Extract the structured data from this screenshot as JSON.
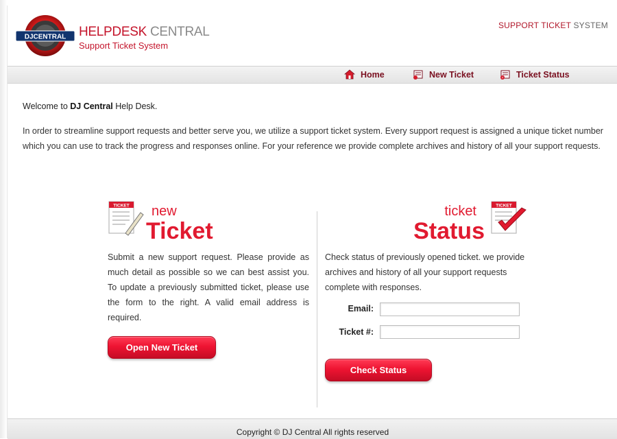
{
  "header": {
    "logo_text": "DJCENTRAL",
    "title_strong": "HELPDESK",
    "title_soft": "CENTRAL",
    "subtitle": "Support Ticket System",
    "system_label_strong": "SUPPORT TICKET",
    "system_label_soft": "SYSTEM"
  },
  "nav": {
    "items": [
      {
        "label": "Home",
        "icon": "home-icon"
      },
      {
        "label": "New Ticket",
        "icon": "new-ticket-icon"
      },
      {
        "label": "Ticket Status",
        "icon": "ticket-status-icon"
      }
    ]
  },
  "intro": {
    "welcome_prefix": "Welcome to",
    "welcome_brand": "DJ Central",
    "welcome_suffix": "Help Desk.",
    "paragraph": "In order to streamline support requests and better serve you, we utilize a support ticket system. Every support request is assigned a unique ticket number which you can use to track the progress and responses online. For your reference we provide complete archives and history of all your support requests."
  },
  "new_ticket": {
    "logo_small": "new",
    "logo_big": "Ticket",
    "description": "Submit a new support request. Please provide as much detail as possible so we can best assist you. To update a previously submitted ticket, please use the form to the right. A valid email address is required.",
    "button_label": "Open New Ticket"
  },
  "ticket_status": {
    "logo_small": "ticket",
    "logo_big": "Status",
    "description": "Check status of previously opened ticket. we provide archives and history of all your support requests complete with responses.",
    "email_label": "Email:",
    "email_value": "",
    "ticket_label": "Ticket #:",
    "ticket_value": "",
    "button_label": "Check Status"
  },
  "footer": {
    "copyright": "Copyright © DJ Central All rights reserved"
  },
  "colors": {
    "brand_red": "#c4142b",
    "nav_text": "#7a1020",
    "button_red": "#ee1432"
  }
}
